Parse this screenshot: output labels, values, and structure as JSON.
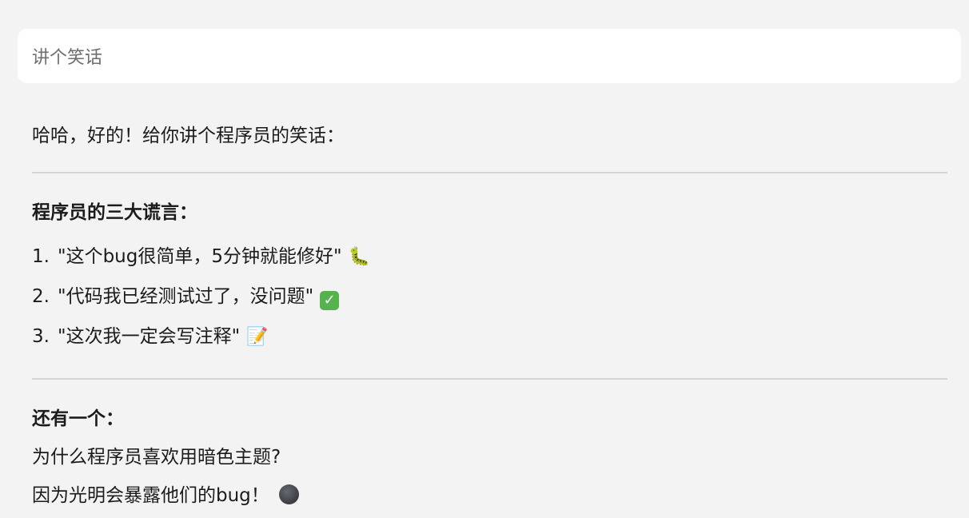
{
  "prompt": {
    "text": "讲个笑话"
  },
  "reply": {
    "intro": "哈哈，好的！给你讲个程序员的笑话：",
    "section1_title": "程序员的三大谎言：",
    "lies": [
      {
        "num": "1.",
        "text": "\"这个bug很简单，5分钟就能修好\"",
        "emoji": "🐛"
      },
      {
        "num": "2.",
        "text": "\"代码我已经测试过了，没问题\"",
        "emoji": "✓"
      },
      {
        "num": "3.",
        "text": "\"这次我一定会写注释\"",
        "emoji": "📝"
      }
    ],
    "section2_title": "还有一个：",
    "question": "为什么程序员喜欢用暗色主题?",
    "answer": "因为光明会暴露他们的bug！"
  },
  "icons": {
    "lie1": "caterpillar-icon",
    "lie2": "check-mark-icon",
    "lie3": "memo-icon",
    "answer": "new-moon-icon"
  }
}
